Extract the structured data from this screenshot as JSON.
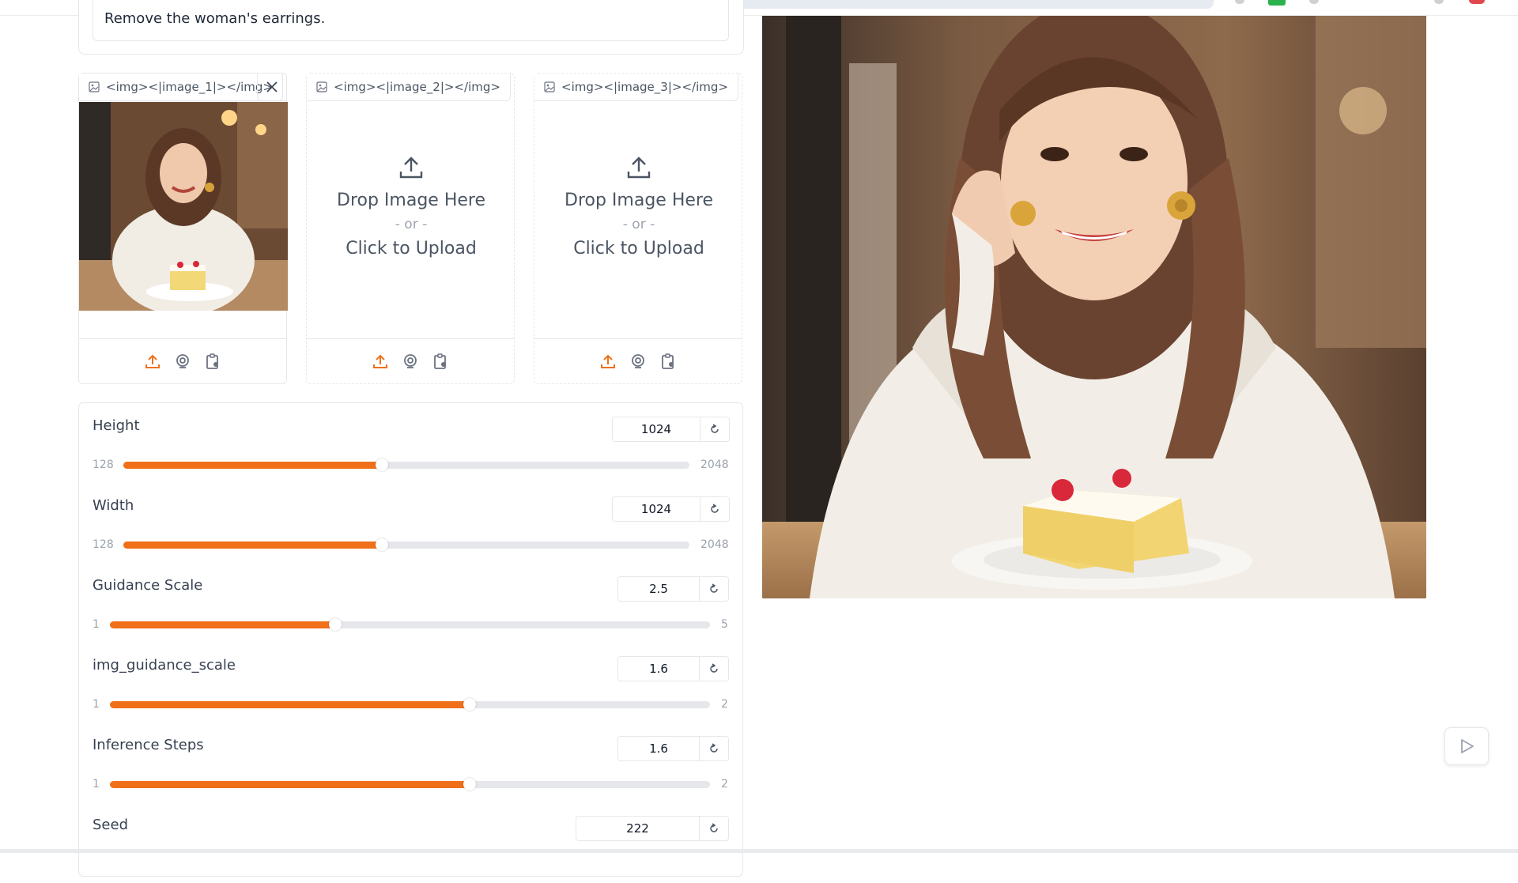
{
  "prompt": {
    "text": "Remove the woman's earrings."
  },
  "uploads": [
    {
      "label": "<img><|image_1|></img>",
      "has_image": true
    },
    {
      "label": "<img><|image_2|></img>",
      "drop_text": "Drop Image Here",
      "or_text": "- or -",
      "click_text": "Click to Upload"
    },
    {
      "label": "<img><|image_3|></img>",
      "drop_text": "Drop Image Here",
      "or_text": "- or -",
      "click_text": "Click to Upload"
    }
  ],
  "params": {
    "height": {
      "label": "Height",
      "value": "1024",
      "min": "128",
      "max": "2048",
      "fraction": 0.457
    },
    "width": {
      "label": "Width",
      "value": "1024",
      "min": "128",
      "max": "2048",
      "fraction": 0.457
    },
    "guidance_scale": {
      "label": "Guidance Scale",
      "value": "2.5",
      "min": "1",
      "max": "5",
      "fraction": 0.375
    },
    "img_guidance_scale": {
      "label": "img_guidance_scale",
      "value": "1.6",
      "min": "1",
      "max": "2",
      "fraction": 0.6
    },
    "inference_steps": {
      "label": "Inference Steps",
      "value": "1.6",
      "min": "1",
      "max": "2",
      "fraction": 0.6
    },
    "seed": {
      "label": "Seed",
      "value": "222"
    }
  },
  "colors": {
    "accent": "#f0701a",
    "track": "#e5e7eb"
  }
}
